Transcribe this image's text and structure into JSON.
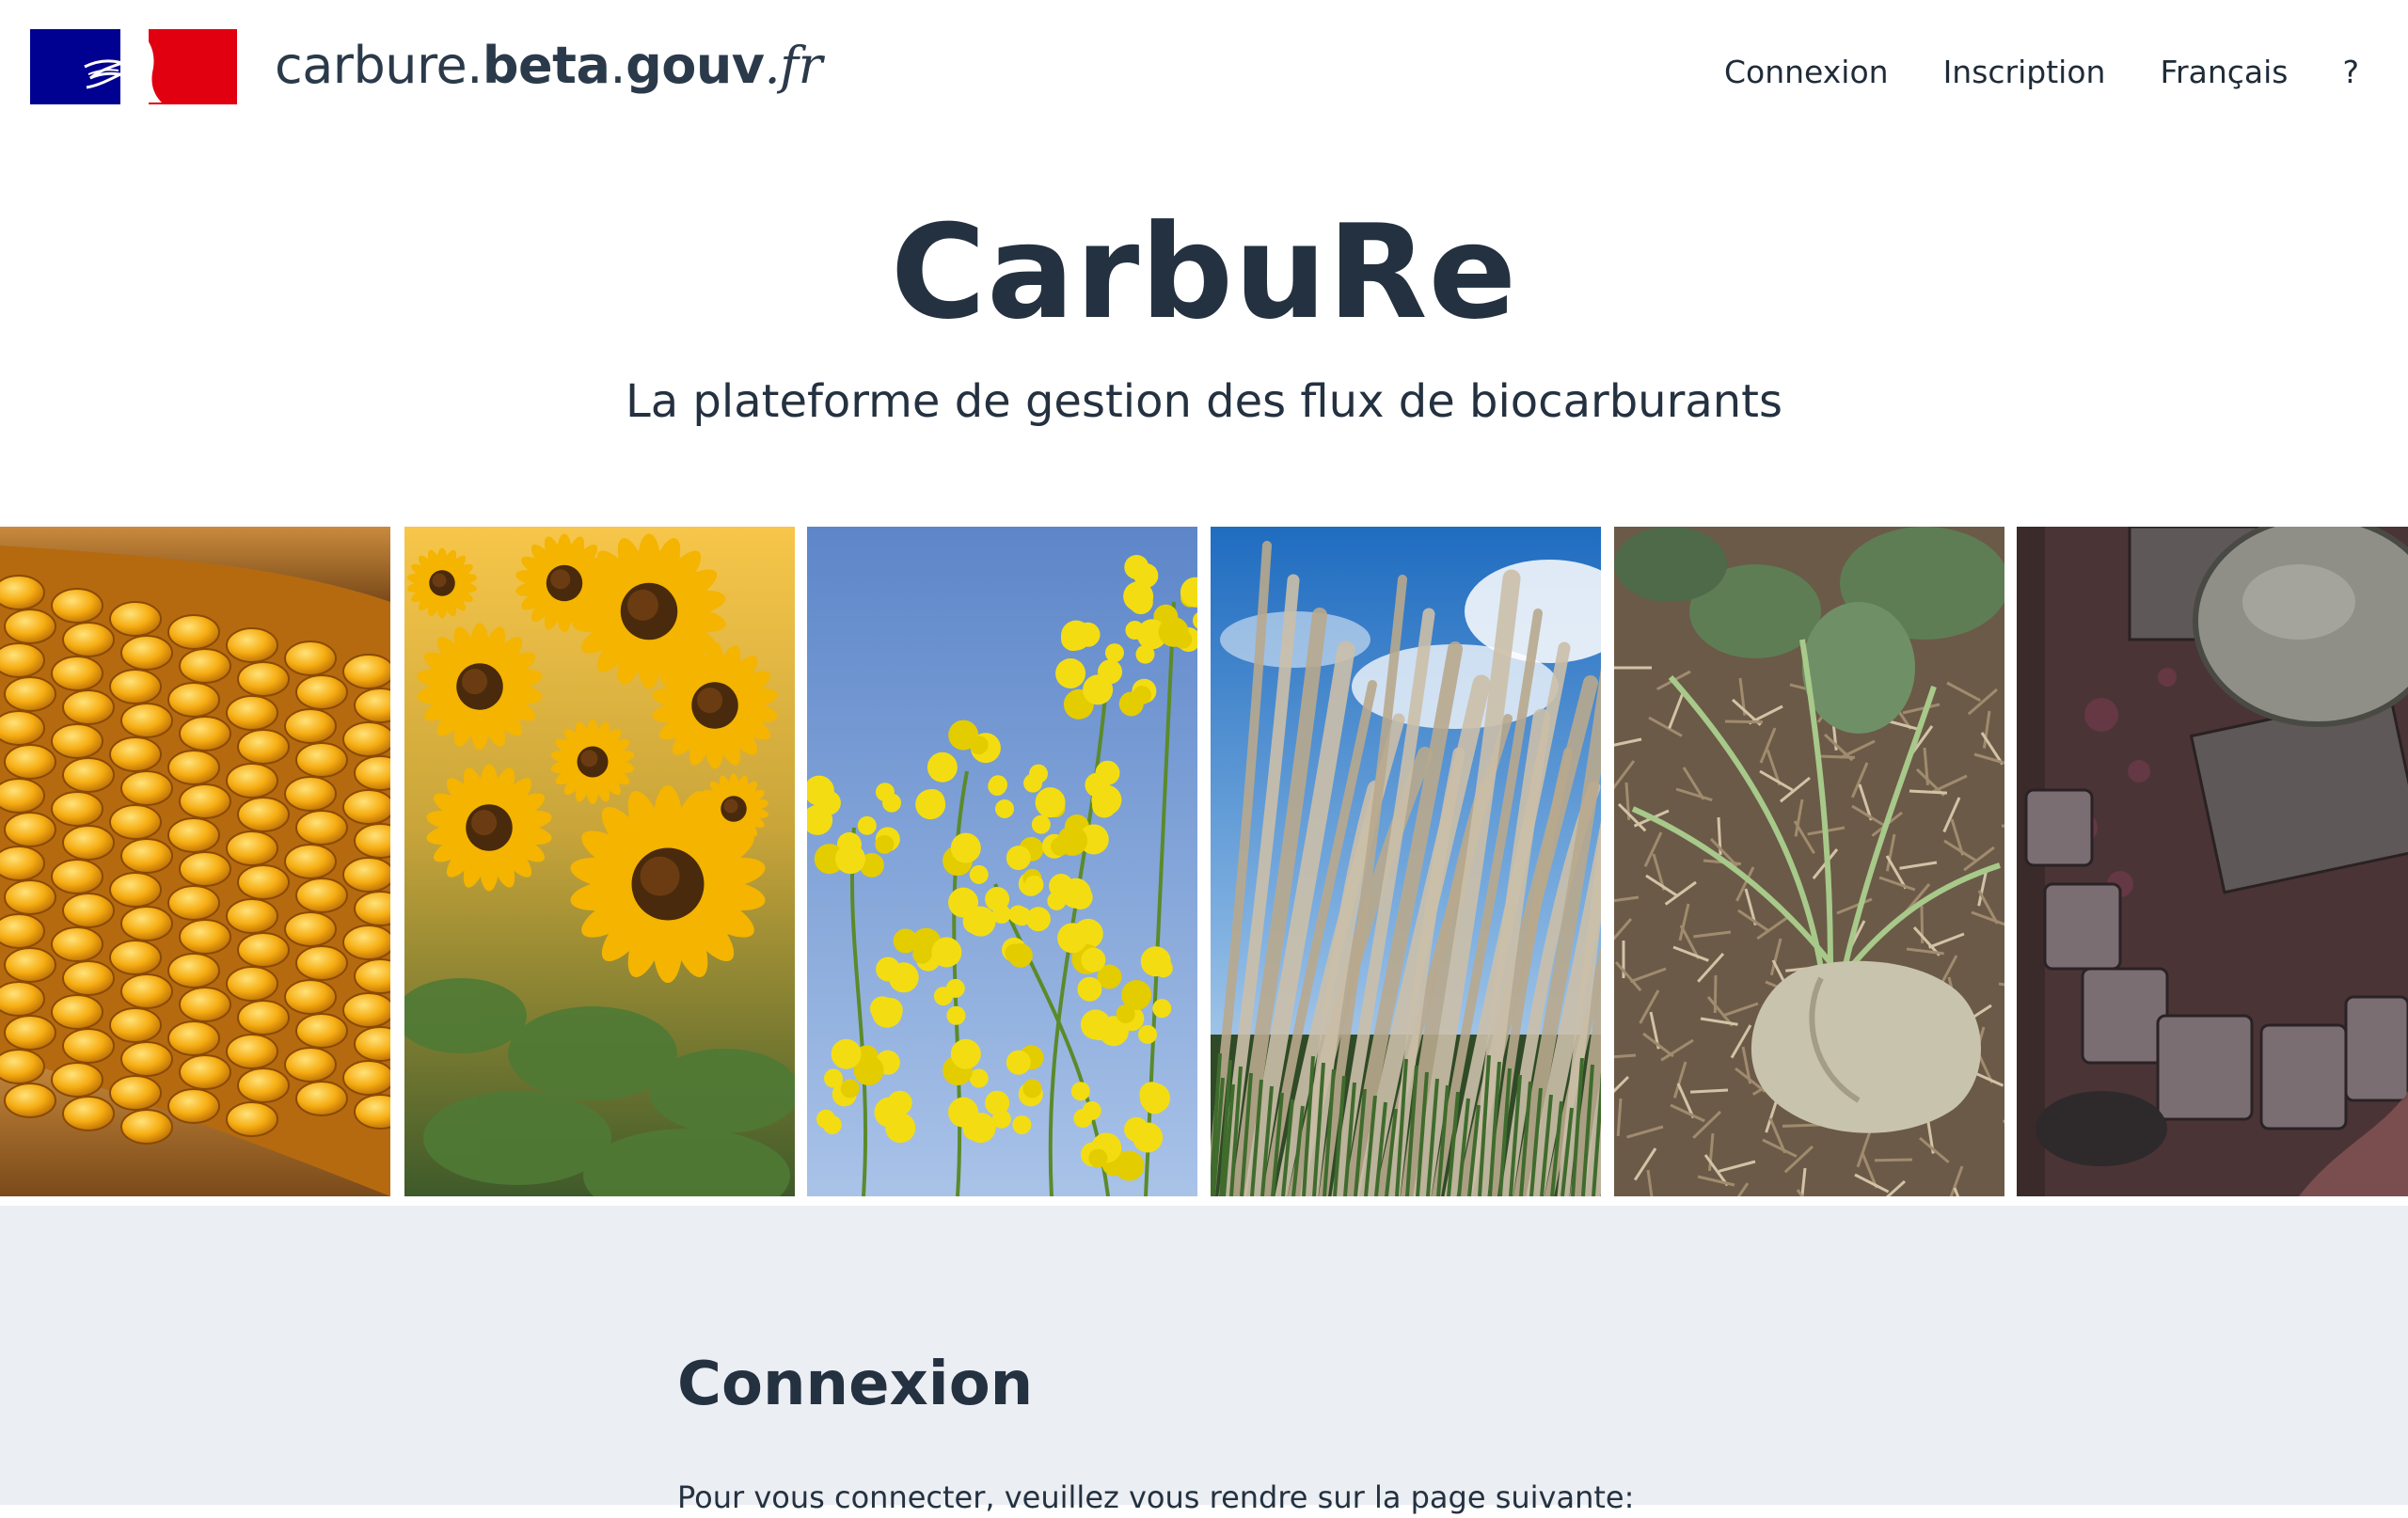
{
  "header": {
    "site_name": {
      "part1": "carbure.",
      "part2": "beta",
      "part3": ".",
      "part4": "gouv",
      "part5": ".fr"
    },
    "nav": {
      "login": "Connexion",
      "register": "Inscription",
      "language": "Français",
      "help": "?"
    }
  },
  "hero": {
    "title": "CarbuRe",
    "subtitle": "La plateforme de gestion des flux de biocarburants"
  },
  "gallery": {
    "images": [
      {
        "subject": "corn-cob"
      },
      {
        "subject": "sunflowers"
      },
      {
        "subject": "rapeseed-flowers"
      },
      {
        "subject": "miscanthus-grass"
      },
      {
        "subject": "sugar-beet"
      },
      {
        "subject": "wine-press-residue"
      }
    ]
  },
  "login": {
    "title": "Connexion",
    "text": "Pour vous connecter, veuillez vous rendre sur la page suivante:"
  },
  "colors": {
    "text_dark": "#243140",
    "section_bg": "#ebeef3",
    "flag_blue": "#000091",
    "flag_red": "#e1000f"
  }
}
